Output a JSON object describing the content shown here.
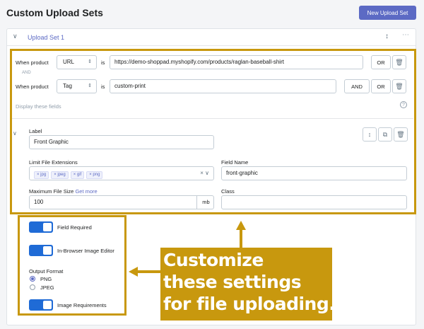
{
  "header": {
    "title": "Custom Upload Sets",
    "new_button": "New Upload Set",
    "accent": "#5c6ac4"
  },
  "upload_set": {
    "title": "Upload Set 1",
    "conditions": [
      {
        "prefix": "When product",
        "type": "URL",
        "operator": "is",
        "value": "https://demo-shoppad.myshopify.com/products/raglan-baseball-shirt",
        "buttons": [
          "OR"
        ]
      },
      {
        "prefix": "When product",
        "type": "Tag",
        "operator": "is",
        "value": "custom-print",
        "buttons": [
          "AND",
          "OR"
        ]
      }
    ],
    "and_separator": "AND",
    "display_fields": "Display these fields",
    "field": {
      "label_caption": "Label",
      "label_value": "Front Graphic",
      "ext_caption": "Limit File Extensions",
      "extensions": [
        "jpg",
        "jpeg",
        "gif",
        "png"
      ],
      "name_caption": "Field Name",
      "name_value": "front-graphic",
      "size_caption": "Maximum File Size",
      "size_link": "Get more",
      "size_value": "100",
      "size_unit": "mb",
      "class_caption": "Class",
      "class_value": ""
    },
    "toggles": {
      "field_required": "Field Required",
      "image_editor": "In-Browser Image Editor",
      "image_requirements": "Image Requirements"
    },
    "output_format": {
      "caption": "Output Format",
      "options": [
        "PNG",
        "JPEG"
      ],
      "selected": "PNG"
    }
  },
  "callout": {
    "lines": [
      "Customize",
      "these settings",
      "for file uploading."
    ],
    "color": "#c8980e"
  }
}
